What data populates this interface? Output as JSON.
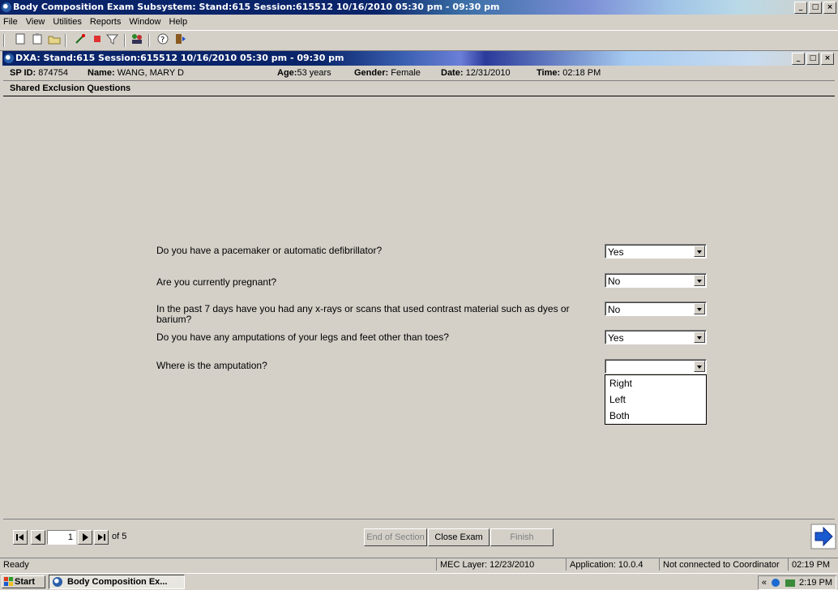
{
  "app_window": {
    "title": "Body Composition Exam Subsystem: Stand:615 Session:615512 10/16/2010 05:30 pm - 09:30 pm",
    "min_label": "_",
    "max_label": "□",
    "close_label": "×"
  },
  "menu": [
    "File",
    "View",
    "Utilities",
    "Reports",
    "Window",
    "Help"
  ],
  "toolbar_icons": [
    "new-icon",
    "clipboard-icon",
    "folder-icon",
    "wand-icon",
    "stop-icon",
    "filter-icon",
    "people-icon",
    "help-icon",
    "exit-icon"
  ],
  "child_window": {
    "title": "DXA: Stand:615 Session:615512 10/16/2010 05:30 pm - 09:30 pm"
  },
  "info": {
    "sp_id_label": "SP ID:",
    "sp_id": "874754",
    "name_label": "Name:",
    "name": "WANG, MARY D",
    "age_label": "Age:",
    "age": "53 years",
    "gender_label": "Gender:",
    "gender": "Female",
    "date_label": "Date:",
    "date": "12/31/2010",
    "time_label": "Time:",
    "time": "02:18 PM"
  },
  "section_title": "Shared Exclusion Questions",
  "questions": [
    {
      "text": "Do you have a pacemaker or automatic defibrillator?",
      "answer": "Yes"
    },
    {
      "text": "Are you currently pregnant?",
      "answer": "No"
    },
    {
      "text": "In the past 7 days have you had any x-rays or scans that used contrast material such as dyes or barium?",
      "answer": "No"
    },
    {
      "text": "Do you have any amputations of your legs and feet other than toes?",
      "answer": "Yes"
    },
    {
      "text": "Where is the amputation?",
      "answer": ""
    }
  ],
  "amputation_options": [
    "Right",
    "Left",
    "Both"
  ],
  "nav": {
    "page": "1",
    "of_label": "of 5",
    "end_of_section": "End of Section",
    "close_exam": "Close Exam",
    "finish": "Finish"
  },
  "status": {
    "ready": "Ready",
    "mec_layer": "MEC Layer: 12/23/2010",
    "application": "Application: 10.0.4",
    "coordinator": "Not connected to Coordinator",
    "time": "02:19 PM"
  },
  "taskbar": {
    "start": "Start",
    "task": "Body Composition Ex...",
    "clock": "2:19 PM",
    "chevron": "«"
  },
  "colors": {
    "title_blue": "#0a246a",
    "title_light": "#a6caf0"
  }
}
